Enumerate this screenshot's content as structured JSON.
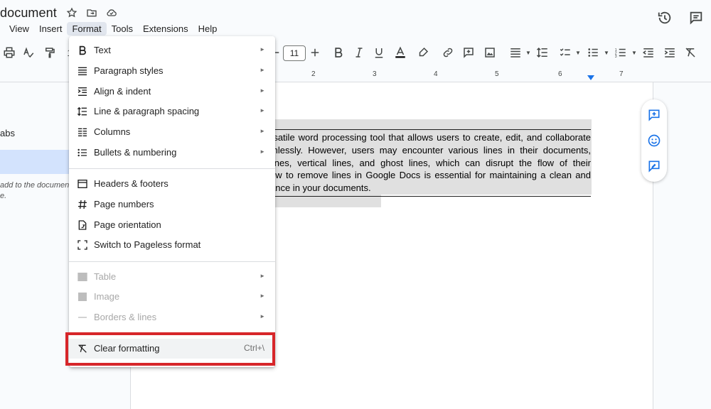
{
  "window": {
    "title": "document"
  },
  "menubar": {
    "items": [
      "View",
      "Insert",
      "Format",
      "Tools",
      "Extensions",
      "Help"
    ],
    "active": "Format"
  },
  "toolbar": {
    "font_size": "11",
    "partial_number": "1"
  },
  "ruler": {
    "numbers": [
      "2",
      "3",
      "4",
      "5",
      "6",
      "7"
    ]
  },
  "left_panel": {
    "tabs_label": "abs",
    "hint_line1": "add to the documen",
    "hint_line2": "e."
  },
  "document": {
    "lines": [
      "rsatile word processing tool that allows users to create, edit, and collaborate",
      "mlessly. However, users may encounter various lines in their documents,",
      " lines, vertical lines, and ghost lines, which can disrupt the flow of their",
      "ow to remove lines in Google Docs is essential for maintaining a clean and",
      "ance in your documents."
    ]
  },
  "format_menu": {
    "items": [
      {
        "label": "Text",
        "icon": "bold-icon",
        "submenu": true
      },
      {
        "label": "Paragraph styles",
        "icon": "paragraph-styles-icon",
        "submenu": true
      },
      {
        "label": "Align & indent",
        "icon": "align-indent-icon",
        "submenu": true
      },
      {
        "label": "Line & paragraph spacing",
        "icon": "line-spacing-icon",
        "submenu": true
      },
      {
        "label": "Columns",
        "icon": "columns-icon",
        "submenu": true
      },
      {
        "label": "Bullets & numbering",
        "icon": "bullets-icon",
        "submenu": true
      },
      {
        "label": "Headers & footers",
        "icon": "header-footer-icon",
        "submenu": false
      },
      {
        "label": "Page numbers",
        "icon": "hash-icon",
        "submenu": false
      },
      {
        "label": "Page orientation",
        "icon": "page-orientation-icon",
        "submenu": false
      },
      {
        "label": "Switch to Pageless format",
        "icon": "pageless-icon",
        "submenu": false
      },
      {
        "label": "Table",
        "icon": "table-icon",
        "submenu": true,
        "disabled": true
      },
      {
        "label": "Image",
        "icon": "image-icon",
        "submenu": true,
        "disabled": true
      },
      {
        "label": "Borders & lines",
        "icon": "borders-icon",
        "submenu": true,
        "disabled": true
      },
      {
        "label": "Clear formatting",
        "icon": "clear-formatting-icon",
        "shortcut": "Ctrl+\\"
      }
    ],
    "submenu_arrow": "►",
    "highlight_color": "#d7262a"
  }
}
